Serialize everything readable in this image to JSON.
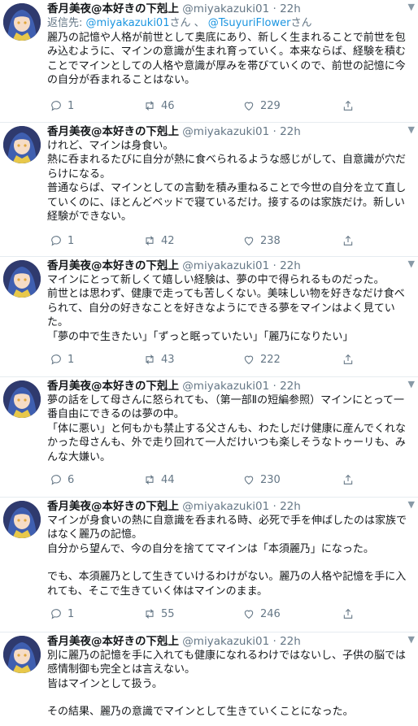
{
  "tweets": [
    {
      "name": "香月美夜@本好きの下剋上",
      "handle": "@miyakazuki01",
      "sep": "·",
      "time": "22h",
      "reply_prefix": "返信先:",
      "reply_to_1": "@miyakazuki01",
      "reply_mid": "さん 、",
      "reply_to_2": "@TsuyuriFlower",
      "reply_suffix": "さん",
      "lines": [
        "麗乃の記憶や人格が前世として奥底にあり、新しく生まれることで前世を包み込むように、マインの意識が生まれ育っていく。本来ならば、経験を積むことでマインとしての人格や意識が厚みを帯びていくので、前世の記憶に今の自分が呑まれることはない。"
      ],
      "replies": "1",
      "retweets": "46",
      "likes": "229"
    },
    {
      "name": "香月美夜@本好きの下剋上",
      "handle": "@miyakazuki01",
      "sep": "·",
      "time": "22h",
      "lines": [
        "けれど、マインは身食い。",
        "熱に呑まれるたびに自分が熱に食べられるような感じがして、自意識が穴だらけになる。",
        "普通ならば、マインとしての言動を積み重ねることで今世の自分を立て直していくのに、ほとんどベッドで寝ているだけ。接するのは家族だけ。新しい経験ができない。"
      ],
      "replies": "1",
      "retweets": "42",
      "likes": "238"
    },
    {
      "name": "香月美夜@本好きの下剋上",
      "handle": "@miyakazuki01",
      "sep": "·",
      "time": "22h",
      "lines": [
        "マインにとって新しくて嬉しい経験は、夢の中で得られるものだった。",
        "前世とは思わず、健康で走っても苦しくない。美味しい物を好きなだけ食べられて、自分の好きなことを好きなようにできる夢をマインはよく見ていた。",
        "「夢の中で生きたい」「ずっと眠っていたい」「麗乃になりたい」"
      ],
      "replies": "1",
      "retweets": "43",
      "likes": "222"
    },
    {
      "name": "香月美夜@本好きの下剋上",
      "handle": "@miyakazuki01",
      "sep": "·",
      "time": "22h",
      "lines": [
        "夢の話をして母さんに怒られても、（第一部Ⅱの短編参照）マインにとって一番自由にできるのは夢の中。",
        "「体に悪い」と何もかも禁止する父さんも、わたしだけ健康に産んでくれなかった母さんも、外で走り回れて一人だけいつも楽しそうなトゥーリも、みんな大嫌い。"
      ],
      "replies": "6",
      "retweets": "44",
      "likes": "230"
    },
    {
      "name": "香月美夜@本好きの下剋上",
      "handle": "@miyakazuki01",
      "sep": "·",
      "time": "22h",
      "lines": [
        "マインが身食いの熱に自意識を呑まれる時、必死で手を伸ばしたのは家族ではなく麗乃の記憶。",
        "自分から望んで、今の自分を捨ててマインは「本須麗乃」になった。",
        "",
        "でも、本須麗乃として生きていけるわけがない。麗乃の人格や記憶を手に入れても、そこで生きていく体はマインのまま。"
      ],
      "replies": "1",
      "retweets": "55",
      "likes": "246"
    },
    {
      "name": "香月美夜@本好きの下剋上",
      "handle": "@miyakazuki01",
      "sep": "·",
      "time": "22h",
      "lines": [
        "別に麗乃の記憶を手に入れても健康になれるわけではないし、子供の脳では感情制御も完全とは言えない。",
        "皆はマインとして扱う。",
        "",
        "その結果、麗乃の意識でマインとして生きていくことになった。"
      ]
    }
  ],
  "icons": {
    "reply": "reply-icon",
    "retweet": "retweet-icon",
    "like": "heart-icon",
    "share": "share-icon",
    "more": "chevron-down-icon"
  },
  "colors": {
    "link": "#1b95e0",
    "secondary": "#657786",
    "text": "#14171a",
    "divider": "#e6ecf0"
  }
}
